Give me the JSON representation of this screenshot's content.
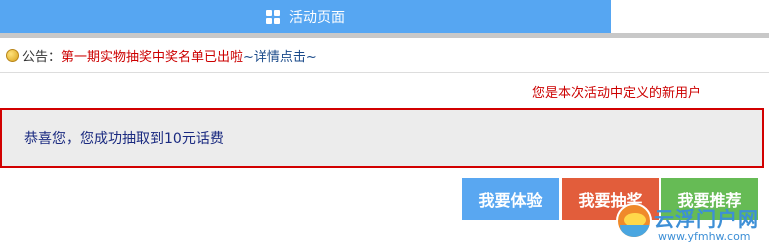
{
  "header": {
    "tab_label": "活动页面",
    "tab_icon": "grid-icon"
  },
  "notice": {
    "icon": "coin-icon",
    "label": "公告：",
    "text": "第一期实物抽奖中奖名单已出啦",
    "link": "~详情点击~"
  },
  "new_user_note": "您是本次活动中定义的新用户",
  "result_message": "恭喜您，您成功抽取到10元话费",
  "buttons": {
    "experience": "我要体验",
    "draw": "我要抽奖",
    "recommend": "我要推荐"
  },
  "watermark": {
    "title": "云浮门户网",
    "url": "www.yfmhw.com"
  },
  "colors": {
    "header_bg": "#56a6f2",
    "notice_red": "#cc0000",
    "result_border": "#d20000",
    "btn_blue": "#59a7f1",
    "btn_red": "#e25d3b",
    "btn_green": "#66bb55"
  }
}
